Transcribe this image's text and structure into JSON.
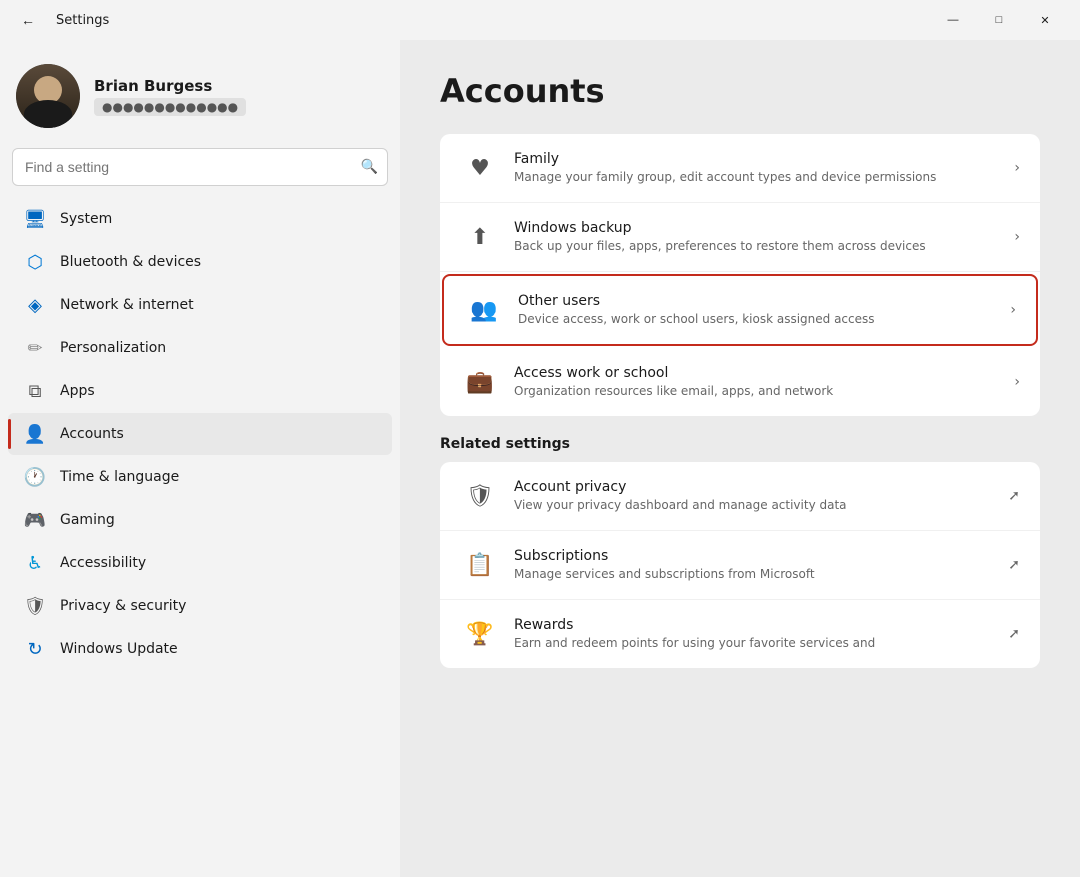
{
  "window": {
    "title": "Settings",
    "controls": {
      "minimize": "—",
      "maximize": "□",
      "close": "✕"
    }
  },
  "user": {
    "name": "Brian Burgess",
    "email": "●●●●●●●●●●●●●"
  },
  "search": {
    "placeholder": "Find a setting"
  },
  "nav": {
    "items": [
      {
        "id": "system",
        "label": "System",
        "icon": "🖥",
        "active": false
      },
      {
        "id": "bluetooth",
        "label": "Bluetooth & devices",
        "icon": "⬡",
        "active": false
      },
      {
        "id": "network",
        "label": "Network & internet",
        "icon": "◈",
        "active": false
      },
      {
        "id": "personalization",
        "label": "Personalization",
        "icon": "✏",
        "active": false
      },
      {
        "id": "apps",
        "label": "Apps",
        "icon": "⧉",
        "active": false
      },
      {
        "id": "accounts",
        "label": "Accounts",
        "icon": "👤",
        "active": true
      },
      {
        "id": "time",
        "label": "Time & language",
        "icon": "🕐",
        "active": false
      },
      {
        "id": "gaming",
        "label": "Gaming",
        "icon": "🎮",
        "active": false
      },
      {
        "id": "accessibility",
        "label": "Accessibility",
        "icon": "♿",
        "active": false
      },
      {
        "id": "privacy",
        "label": "Privacy & security",
        "icon": "🛡",
        "active": false
      },
      {
        "id": "update",
        "label": "Windows Update",
        "icon": "↻",
        "active": false
      }
    ]
  },
  "main": {
    "page_title": "Accounts",
    "settings_items": [
      {
        "id": "family",
        "icon": "♥",
        "title": "Family",
        "description": "Manage your family group, edit account types and device permissions",
        "arrow": "›",
        "highlighted": false,
        "external": false
      },
      {
        "id": "windows-backup",
        "icon": "⬆",
        "title": "Windows backup",
        "description": "Back up your files, apps, preferences to restore them across devices",
        "arrow": "›",
        "highlighted": false,
        "external": false
      },
      {
        "id": "other-users",
        "icon": "👥",
        "title": "Other users",
        "description": "Device access, work or school users, kiosk assigned access",
        "arrow": "›",
        "highlighted": true,
        "external": false
      },
      {
        "id": "access-work",
        "icon": "💼",
        "title": "Access work or school",
        "description": "Organization resources like email, apps, and network",
        "arrow": "›",
        "highlighted": false,
        "external": false
      }
    ],
    "related_settings": {
      "label": "Related settings",
      "items": [
        {
          "id": "account-privacy",
          "icon": "🛡",
          "title": "Account privacy",
          "description": "View your privacy dashboard and manage activity data",
          "external": true
        },
        {
          "id": "subscriptions",
          "icon": "📋",
          "title": "Subscriptions",
          "description": "Manage services and subscriptions from Microsoft",
          "external": true
        },
        {
          "id": "rewards",
          "icon": "🏆",
          "title": "Rewards",
          "description": "Earn and redeem points for using your favorite services and",
          "external": true
        }
      ]
    }
  }
}
